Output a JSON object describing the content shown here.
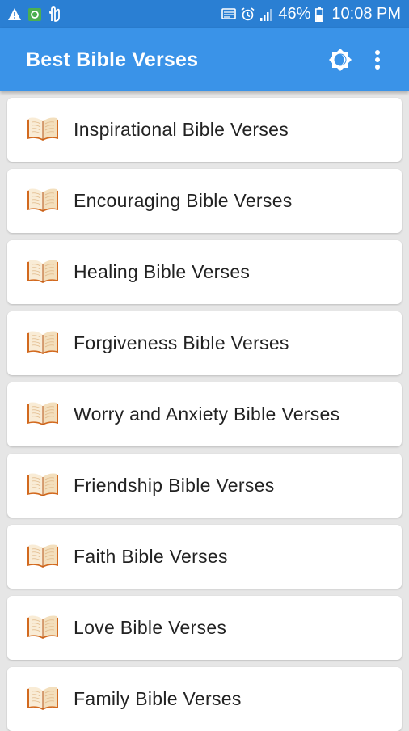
{
  "status_bar": {
    "battery": "46%",
    "time": "10:08 PM",
    "icons": [
      "warning-icon",
      "app-icon",
      "hand-icon",
      "cast-icon",
      "alarm-icon",
      "signal-icon",
      "battery-icon"
    ]
  },
  "app_bar": {
    "title": "Best Bible Verses",
    "actions": [
      "brightness-icon",
      "more-vert-icon"
    ]
  },
  "categories": [
    {
      "label": "Inspirational Bible Verses",
      "icon": "book-icon"
    },
    {
      "label": "Encouraging Bible Verses",
      "icon": "book-icon"
    },
    {
      "label": "Healing Bible Verses",
      "icon": "book-icon"
    },
    {
      "label": "Forgiveness Bible Verses",
      "icon": "book-icon"
    },
    {
      "label": "Worry and Anxiety Bible Verses",
      "icon": "book-icon"
    },
    {
      "label": "Friendship Bible Verses",
      "icon": "book-icon"
    },
    {
      "label": "Faith Bible Verses",
      "icon": "book-icon"
    },
    {
      "label": "Love Bible Verses",
      "icon": "book-icon"
    },
    {
      "label": "Family Bible Verses",
      "icon": "book-icon"
    }
  ],
  "colors": {
    "status_bar": "#2a7fd3",
    "app_bar": "#3a93e8",
    "background": "#e6e6e6",
    "card": "#ffffff",
    "book_cover": "#d2691e",
    "book_pages": "#f7e8cf"
  }
}
